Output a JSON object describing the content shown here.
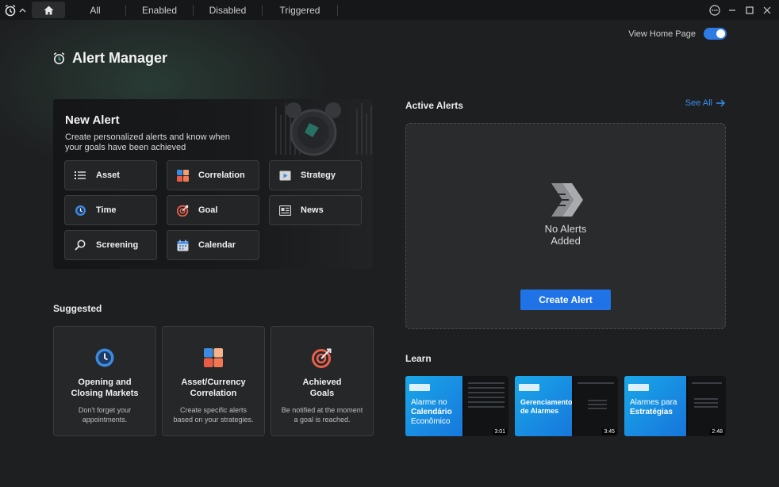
{
  "titlebar": {
    "tabs": [
      {
        "label": "All"
      },
      {
        "label": "Enabled"
      },
      {
        "label": "Disabled"
      },
      {
        "label": "Triggered"
      }
    ]
  },
  "header": {
    "title": "Alert Manager",
    "home_toggle_label": "View Home Page",
    "home_toggle_on": true
  },
  "new_alert": {
    "title": "New Alert",
    "description": "Create personalized alerts and know when your goals have been achieved",
    "buttons": [
      {
        "label": "Asset",
        "icon": "list-icon"
      },
      {
        "label": "Correlation",
        "icon": "correlation-icon"
      },
      {
        "label": "Strategy",
        "icon": "strategy-icon"
      },
      {
        "label": "Time",
        "icon": "clock-icon"
      },
      {
        "label": "Goal",
        "icon": "target-icon"
      },
      {
        "label": "News",
        "icon": "news-icon"
      },
      {
        "label": "Screening",
        "icon": "search-icon"
      },
      {
        "label": "Calendar",
        "icon": "calendar-icon"
      }
    ]
  },
  "suggested": {
    "label": "Suggested",
    "cards": [
      {
        "title_line1": "Opening and",
        "title_line2": "Closing Markets",
        "desc_line1": "Don't forget your",
        "desc_line2": "appointments."
      },
      {
        "title_line1": "Asset/Currency",
        "title_line2": "Correlation",
        "desc_line1": "Create specific alerts",
        "desc_line2": "based on your strategies."
      },
      {
        "title_line1": "Achieved",
        "title_line2": "Goals",
        "desc_line1": "Be notified at the moment",
        "desc_line2": "a goal is reached."
      }
    ]
  },
  "active_alerts": {
    "label": "Active Alerts",
    "see_all": "See All",
    "empty_line1": "No Alerts",
    "empty_line2": "Added",
    "create_button": "Create Alert"
  },
  "learn": {
    "label": "Learn",
    "videos": [
      {
        "line1": "Alarme no",
        "line2": "Calendário",
        "line3": "Econômico",
        "duration": "3:01"
      },
      {
        "line1": "Gerenciamento",
        "line2": "de Alarmes",
        "line3": "",
        "duration": "3:45"
      },
      {
        "line1": "Alarmes para",
        "line2": "Estratégias",
        "line3": "",
        "duration": "2:48"
      }
    ]
  },
  "colors": {
    "accent": "#1f73e6",
    "link": "#3a8ff0",
    "background": "#1e1f20"
  }
}
